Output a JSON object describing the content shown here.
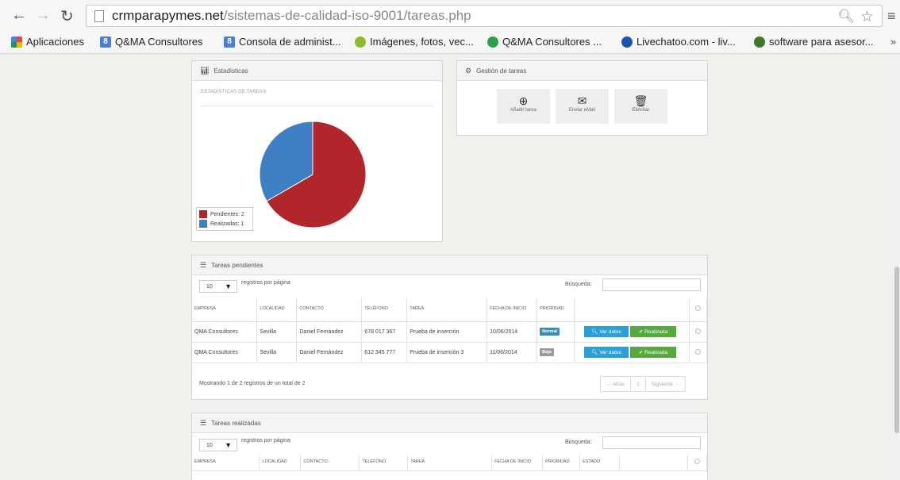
{
  "browser": {
    "url_domain": "crmparapymes.net",
    "url_path": "/sistemas-de-calidad-iso-9001/tareas.php",
    "bookmarks": [
      {
        "label": "Aplicaciones",
        "icon": "apps-grid-icon",
        "color": "#e8453c"
      },
      {
        "label": "Q&MA Consultores",
        "icon": "google-sites-icon",
        "color": "#4a7fd6"
      },
      {
        "label": "Consola de administ...",
        "icon": "google-sites-icon",
        "color": "#4a7fd6"
      },
      {
        "label": "Imágenes, fotos, vec...",
        "icon": "circle-logo-icon",
        "color": "#8cbc2c"
      },
      {
        "label": "Q&MA Consultores ...",
        "icon": "chat-bubble-icon",
        "color": "#2ea04a"
      },
      {
        "label": "Livechatoo.com - liv...",
        "icon": "live-chat-icon",
        "color": "#2050b0"
      },
      {
        "label": "software para asesor...",
        "icon": "shield-icon",
        "color": "#3f7a2b"
      }
    ],
    "more_label": "»"
  },
  "stats_panel": {
    "title": "Estadísticas",
    "subtitle": "ESTADÍSTICAS DE TAREAS",
    "legend": [
      {
        "label": "Pendientes: 2",
        "color": "#b0262b"
      },
      {
        "label": "Realizadas: 1",
        "color": "#3f80c4"
      }
    ]
  },
  "chart_data": {
    "type": "pie",
    "title": "ESTADÍSTICAS DE TAREAS",
    "categories": [
      "Pendientes",
      "Realizadas"
    ],
    "values": [
      2,
      1
    ],
    "colors": [
      "#b0262b",
      "#3f80c4"
    ],
    "legend_position": "bottom-left"
  },
  "tasks_panel": {
    "title": "Gestión de tareas",
    "buttons": [
      {
        "label": "Añadir tarea",
        "icon": "plus-circle-icon"
      },
      {
        "label": "Enviar eMail",
        "icon": "envelope-icon"
      },
      {
        "label": "Eliminar",
        "icon": "trash-icon"
      }
    ]
  },
  "pending": {
    "title": "Tareas pendientes",
    "length_value": "10",
    "per_page_label": "registros por página",
    "search_label": "Búsqueda:",
    "columns": [
      "EMPRESA",
      "LOCALIDAD",
      "CONTACTO",
      "TELÉFONO",
      "TAREA",
      "FECHA DE INICIO",
      "PRIORIDAD"
    ],
    "rows": [
      {
        "empresa": "QMA Consultores",
        "localidad": "Sevilla",
        "contacto": "Daniel Fernández",
        "telefono": "678 017 367",
        "tarea": "Prueba de inserción",
        "fecha": "10/06/2014",
        "prioridad": "Normal",
        "prio_color": "#3b8db5"
      },
      {
        "empresa": "QMA Consultores",
        "localidad": "Sevilla",
        "contacto": "Daniel Fernández",
        "telefono": "612 345 777",
        "tarea": "Prueba de inserción 3",
        "fecha": "11/06/2014",
        "prioridad": "Baja",
        "prio_color": "#999999"
      }
    ],
    "view_label": "Ver datos",
    "done_label": "Realizada",
    "info": "Mostrando 1 de 2 registros de un total de 2",
    "pager": {
      "prev": "← Atrás",
      "page": "1",
      "next": "Siguiente →"
    }
  },
  "done": {
    "title": "Tareas realizadas",
    "length_value": "10",
    "per_page_label": "registros por página",
    "search_label": "Búsqueda:",
    "columns": [
      "EMPRESA",
      "LOCALIDAD",
      "CONTACTO",
      "TELÉFONO",
      "TAREA",
      "FECHA DE INICIO",
      "PRIORIDAD",
      "ESTADO"
    ]
  }
}
